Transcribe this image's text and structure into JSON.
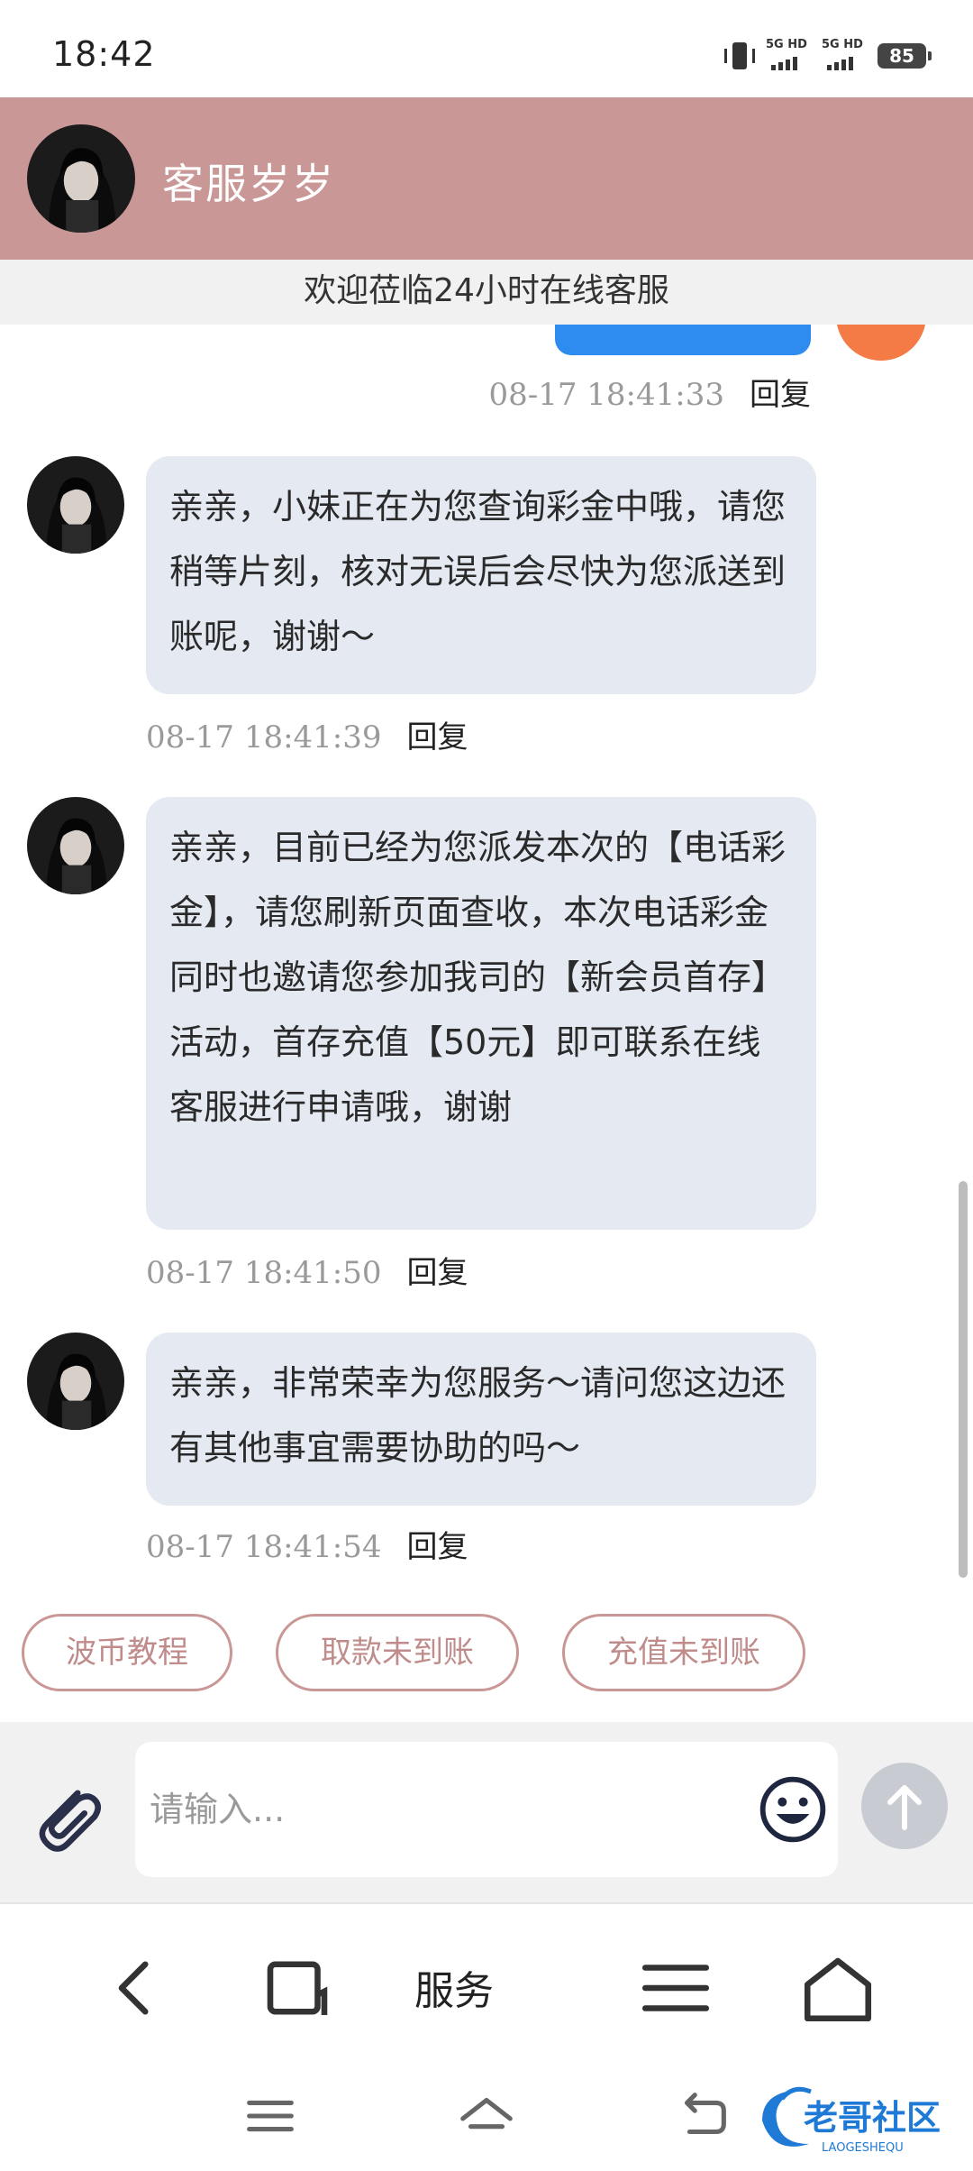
{
  "status_bar": {
    "time": "18:42",
    "network1": "5G HD",
    "network2": "5G HD",
    "battery": "85"
  },
  "header": {
    "agent_name": "客服岁岁",
    "welcome": "欢迎莅临24小时在线客服"
  },
  "sent": {
    "timestamp": "08-17 18:41:33",
    "reply": "回复"
  },
  "messages": [
    {
      "text": "亲亲，小妹正在为您查询彩金中哦，请您稍等片刻，核对无误后会尽快为您派送到账呢，谢谢～",
      "timestamp": "08-17 18:41:39",
      "reply": "回复"
    },
    {
      "text": "亲亲，目前已经为您派发本次的【电话彩金】，请您刷新页面查收，本次电话彩金同时也邀请您参加我司的【新会员首存】活动，首存充值【50元】即可联系在线客服进行申请哦，谢谢",
      "timestamp": "08-17 18:41:50",
      "reply": "回复"
    },
    {
      "text": "亲亲，非常荣幸为您服务～请问您这边还有其他事宜需要协助的吗～",
      "timestamp": "08-17 18:41:54",
      "reply": "回复"
    }
  ],
  "quick_replies": [
    "波币教程",
    "取款未到账",
    "充值未到账"
  ],
  "input": {
    "placeholder": "请输入..."
  },
  "browser_nav": {
    "service": "服务"
  },
  "watermark": {
    "text": "老哥社区",
    "sub": "LAOGESHEQU"
  },
  "colors": {
    "header": "#c99796",
    "bubble": "#e5e9f2",
    "sent_bubble": "#2e8cf0",
    "accent": "#c08c8b"
  },
  "icons": [
    "vibrate-icon",
    "signal-icon",
    "battery-icon",
    "paperclip-icon",
    "smiley-icon",
    "arrow-up-icon",
    "back-icon",
    "tabs-icon",
    "menu-icon",
    "home-icon"
  ]
}
